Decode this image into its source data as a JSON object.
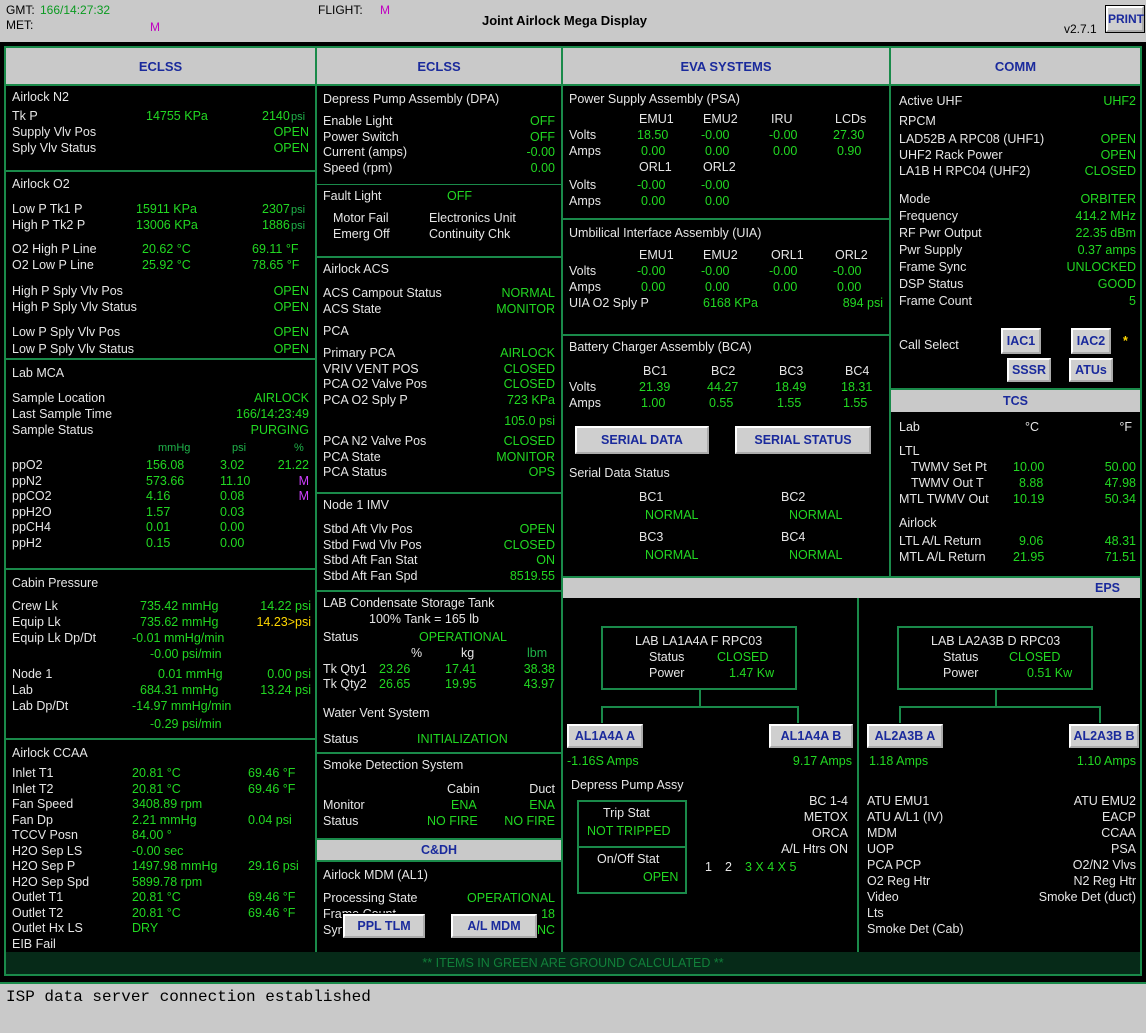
{
  "header": {
    "gmt_label": "GMT:",
    "gmt": "166/14:27:32",
    "met_label": "MET:",
    "met": "M",
    "flight_label": "FLIGHT:",
    "flight": "M",
    "title": "Joint Airlock Mega Display",
    "version": "v2.7.1",
    "print": "PRINT"
  },
  "cols": {
    "eclss1": "ECLSS",
    "eclss2": "ECLSS",
    "eva": "EVA SYSTEMS",
    "comm": "COMM",
    "tcs": "TCS",
    "cdh": "C&DH",
    "eps": "EPS"
  },
  "n2": {
    "title": "Airlock N2",
    "tkp": "Tk P",
    "tkp_kpa": "14755 KPa",
    "tkp_psi": "2140",
    "supply": "Supply Vlv Pos",
    "supply_v": "OPEN",
    "sply": "Sply Vlv Status",
    "sply_v": "OPEN"
  },
  "o2": {
    "title": "Airlock O2",
    "lp1": "Low P Tk1 P",
    "lp1_kpa": "15911 KPa",
    "lp1_psi": "2307",
    "hp2": "High P Tk2 P",
    "hp2_kpa": "13006 KPa",
    "hp2_psi": "1886",
    "o2h": "O2 High P Line",
    "o2h_c": "20.62 °C",
    "o2h_f": "69.11 °F",
    "o2l": "O2 Low P Line",
    "o2l_c": "25.92 °C",
    "o2l_f": "78.65 °F",
    "hsp": "High P Sply Vlv Pos",
    "hsp_v": "OPEN",
    "hss": "High P Sply Vlv Status",
    "hss_v": "OPEN",
    "lsp": "Low P Sply Vlv Pos",
    "lsp_v": "OPEN",
    "lss": "Low P Sply Vlv Status",
    "lss_v": "OPEN"
  },
  "mca": {
    "title": "Lab MCA",
    "loc": "Sample Location",
    "loc_v": "AIRLOCK",
    "last": "Last Sample Time",
    "last_v": "166/14:23:49",
    "stat": "Sample Status",
    "stat_v": "PURGING",
    "h_mmhg": "mmHg",
    "h_psi": "psi",
    "h_pct": "%",
    "rows": [
      [
        "ppO2",
        "156.08",
        "3.02",
        "21.22"
      ],
      [
        "ppN2",
        "573.66",
        "11.10",
        "M"
      ],
      [
        "ppCO2",
        "4.16",
        "0.08",
        "M"
      ],
      [
        "ppH2O",
        "1.57",
        "0.03",
        ""
      ],
      [
        "ppCH4",
        "0.01",
        "0.00",
        ""
      ],
      [
        "ppH2",
        "0.15",
        "0.00",
        ""
      ]
    ]
  },
  "cab": {
    "title": "Cabin Pressure",
    "crew": "Crew Lk",
    "crew_v": "735.42 mmHg",
    "crew_p": "14.22 psi",
    "equip": "Equip Lk",
    "equip_v": "735.62 mmHg",
    "equip_p": "14.23>psi",
    "dp": "Equip Lk Dp/Dt",
    "dp_v": "-0.01 mmHg/min",
    "dp_p": "-0.00 psi/min",
    "node": "Node 1",
    "node_v": "0.01 mmHg",
    "node_p": "0.00 psi",
    "lab": "Lab",
    "lab_v": "684.31 mmHg",
    "lab_p": "13.24 psi",
    "labdp": "Lab Dp/Dt",
    "labdp_v": "-14.97 mmHg/min",
    "labdp_p": "-0.29 psi/min"
  },
  "ccaa": {
    "title": "Airlock CCAA",
    "rows": [
      [
        "Inlet T1",
        "20.81 °C",
        "69.46 °F"
      ],
      [
        "Inlet T2",
        "20.81 °C",
        "69.46 °F"
      ],
      [
        "Fan Speed",
        "3408.89 rpm",
        ""
      ],
      [
        "Fan Dp",
        "2.21 mmHg",
        "0.04 psi"
      ],
      [
        "TCCV Posn",
        "84.00 °",
        ""
      ],
      [
        "H2O Sep LS",
        "-0.00 sec",
        ""
      ],
      [
        "H2O Sep P",
        "1497.98 mmHg",
        "29.16 psi"
      ],
      [
        "H2O Sep Spd",
        "5899.78 rpm",
        ""
      ],
      [
        "Outlet T1",
        "20.81 °C",
        "69.46 °F"
      ],
      [
        "Outlet T2",
        "20.81 °C",
        "69.46 °F"
      ],
      [
        "Outlet Hx LS",
        "DRY",
        ""
      ],
      [
        "EIB Fail",
        "",
        ""
      ]
    ]
  },
  "dpa": {
    "title": "Depress Pump Assembly (DPA)",
    "rows": [
      [
        "Enable Light",
        "OFF"
      ],
      [
        "Power Switch",
        "OFF"
      ],
      [
        "Current (amps)",
        "-0.00"
      ],
      [
        "Speed (rpm)",
        "0.00"
      ]
    ],
    "fault": "Fault Light",
    "fault_v": "OFF",
    "mf": "Motor Fail",
    "eu": "Electronics Unit",
    "eo": "Emerg Off",
    "cc": "Continuity Chk"
  },
  "acs": {
    "title": "Airlock ACS",
    "camp": "ACS Campout Status",
    "camp_v": "NORMAL",
    "state": "ACS State",
    "state_v": "MONITOR"
  },
  "pca": {
    "title": "PCA",
    "rows": [
      [
        "Primary PCA",
        "AIRLOCK"
      ],
      [
        "VRIV VENT POS",
        "CLOSED"
      ],
      [
        "PCA O2 Valve Pos",
        "CLOSED"
      ],
      [
        "PCA O2 Sply P",
        "723 KPa"
      ]
    ],
    "psi": "105.0 psi",
    "rows2": [
      [
        "PCA N2 Valve Pos",
        "CLOSED"
      ],
      [
        "PCA State",
        "MONITOR"
      ],
      [
        "PCA Status",
        "OPS"
      ]
    ]
  },
  "imv": {
    "title": "Node 1 IMV",
    "rows": [
      [
        "Stbd Aft Vlv Pos",
        "OPEN"
      ],
      [
        "Stbd Fwd Vlv Pos",
        "CLOSED"
      ],
      [
        "Stbd Aft Fan Stat",
        "ON"
      ],
      [
        "Stbd Aft Fan Spd",
        "8519.55"
      ]
    ]
  },
  "cond": {
    "title": "LAB Condensate Storage Tank",
    "sub": "100% Tank = 165 lb",
    "status": "Status",
    "status_v": "OPERATIONAL",
    "h_pct": "%",
    "h_kg": "kg",
    "h_lbm": "lbm",
    "q1": "Tk Qty1",
    "q1a": "23.26",
    "q1b": "17.41",
    "q1c": "38.38",
    "q2": "Tk Qty2",
    "q2a": "26.65",
    "q2b": "19.95",
    "q2c": "43.97"
  },
  "wv": {
    "title": "Water Vent System",
    "status": "Status",
    "status_v": "INITIALIZATION"
  },
  "smoke": {
    "title": "Smoke Detection System",
    "cabin": "Cabin",
    "duct": "Duct",
    "mon": "Monitor",
    "mon_c": "ENA",
    "mon_d": "ENA",
    "st": "Status",
    "st_c": "NO FIRE",
    "st_d": "NO FIRE"
  },
  "mdm": {
    "title": "Airlock MDM (AL1)",
    "proc": "Processing State",
    "proc_v": "OPERATIONAL",
    "fc": "Frame Count",
    "fc_v": "18",
    "sync": "Sync Status",
    "sync_v": "IN SYNC",
    "b1": "PPL TLM",
    "b2": "A/L MDM"
  },
  "psa": {
    "title": "Power Supply Assembly (PSA)",
    "hdr": [
      "EMU1",
      "EMU2",
      "IRU",
      "LCDs"
    ],
    "volts": "Volts",
    "amps": "Amps",
    "v1": [
      "18.50",
      "-0.00",
      "-0.00",
      "27.30"
    ],
    "a1": [
      "0.00",
      "0.00",
      "0.00",
      "0.90"
    ],
    "hdr2": [
      "ORL1",
      "ORL2"
    ],
    "v2": [
      "-0.00",
      "-0.00"
    ],
    "a2": [
      "0.00",
      "0.00"
    ]
  },
  "uia": {
    "title": "Umbilical Interface Assembly (UIA)",
    "hdr": [
      "EMU1",
      "EMU2",
      "ORL1",
      "ORL2"
    ],
    "v": [
      "-0.00",
      "-0.00",
      "-0.00",
      "-0.00"
    ],
    "a": [
      "0.00",
      "0.00",
      "0.00",
      "0.00"
    ],
    "o2": "UIA O2 Sply P",
    "o2_kpa": "6168 KPa",
    "o2_psi": "894 psi"
  },
  "bca": {
    "title": "Battery Charger Assembly (BCA)",
    "hdr": [
      "BC1",
      "BC2",
      "BC3",
      "BC4"
    ],
    "v": [
      "21.39",
      "44.27",
      "18.49",
      "18.31"
    ],
    "a": [
      "1.00",
      "0.55",
      "1.55",
      "1.55"
    ],
    "b1": "SERIAL DATA",
    "b2": "SERIAL STATUS",
    "sds": "Serial Data Status",
    "bc1": "BC1",
    "bc2": "BC2",
    "bc3": "BC3",
    "bc4": "BC4",
    "n": "NORMAL"
  },
  "comm": {
    "uhf": "Active UHF",
    "uhf_v": "UHF2",
    "rpcm": "RPCM",
    "r1": "LAD52B A RPC08 (UHF1)",
    "r1v": "OPEN",
    "r2": "UHF2 Rack Power",
    "r2v": "OPEN",
    "r3": "LA1B H RPC04 (UHF2)",
    "r3v": "CLOSED",
    "rows": [
      [
        "Mode",
        "ORBITER"
      ],
      [
        "Frequency",
        "414.2 MHz"
      ],
      [
        "RF Pwr Output",
        "22.35 dBm"
      ],
      [
        "Pwr Supply",
        "0.37 amps"
      ],
      [
        "Frame Sync",
        "UNLOCKED"
      ],
      [
        "DSP Status",
        "GOOD"
      ],
      [
        "Frame Count",
        "5"
      ]
    ],
    "call": "Call Select",
    "iac1": "IAC1",
    "iac2": "IAC2",
    "star": "*",
    "sssr": "SSSR",
    "atus": "ATUs"
  },
  "tcs": {
    "lab": "Lab",
    "c": "°C",
    "f": "°F",
    "ltl": "LTL",
    "r1": "TWMV Set Pt",
    "r1c": "10.00",
    "r1f": "50.00",
    "r2": "TWMV Out T",
    "r2c": "8.88",
    "r2f": "47.98",
    "r3": "MTL TWMV Out",
    "r3c": "10.19",
    "r3f": "50.34",
    "al": "Airlock",
    "r4": "LTL A/L Return",
    "r4c": "9.06",
    "r4f": "48.31",
    "r5": "MTL A/L Return",
    "r5c": "21.95",
    "r5f": "71.51"
  },
  "eps": {
    "a_title": "LAB LA1A4A F RPC03",
    "status": "Status",
    "a_status": "CLOSED",
    "power": "Power",
    "a_power": "1.47 Kw",
    "b_title": "LAB LA2A3B D RPC03",
    "b_status": "CLOSED",
    "b_power": "0.51 Kw",
    "btn1": "AL1A4A A",
    "btn2": "AL1A4A B",
    "btn3": "AL2A3B A",
    "btn4": "AL2A3B B",
    "amp1": "-1.16S Amps",
    "amp2": "9.17 Amps",
    "amp3": "1.18 Amps",
    "amp4": "1.10 Amps",
    "dpa": "Depress Pump Assy",
    "trip": "Trip Stat",
    "trip_v": "NOT TRIPPED",
    "onoff": "On/Off Stat",
    "onoff_v": "OPEN",
    "n1": "1",
    "n2": "2",
    "n3": "3 X 4 X 5",
    "bc": "BC 1-4",
    "metox": "METOX",
    "orca": "ORCA",
    "htrs": "A/L Htrs ON",
    "left": [
      "ATU EMU1",
      "ATU A/L1 (IV)",
      "MDM",
      "UOP",
      "PCA PCP",
      "O2 Reg Htr",
      "Video",
      "Lts",
      "Smoke Det (Cab)"
    ],
    "right": [
      "ATU EMU2",
      "EACP",
      "CCAA",
      "PSA",
      "O2/N2 Vlvs",
      "N2 Reg Htr",
      "Smoke Det (duct)"
    ]
  },
  "footer": "** ITEMS IN GREEN ARE GROUND CALCULATED **",
  "status": "ISP data server connection established"
}
